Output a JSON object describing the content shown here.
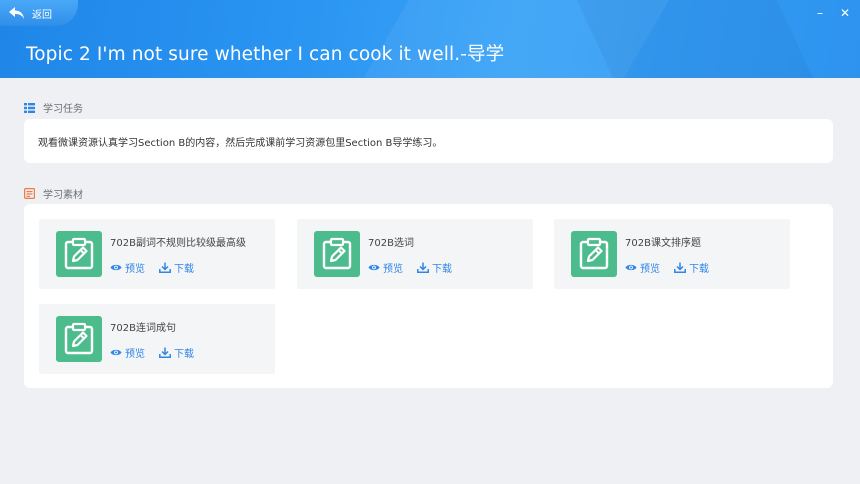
{
  "window": {
    "back_label": "返回",
    "minimize_symbol": "–",
    "close_symbol": "✕",
    "title": "Topic 2 I'm not sure whether I can cook it well.-导学",
    "brand_color": "#2a95f2"
  },
  "task": {
    "section_title": "学习任务",
    "section_icon": "list-icon",
    "text": "观看微课资源认真学习Section B的内容，然后完成课前学习资源包里Section B导学练习。"
  },
  "materials": {
    "section_title": "学习素材",
    "section_icon": "document-icon",
    "thumb_icon": "edit-clipboard-icon",
    "thumb_color": "#4cbc8c",
    "preview_label": "预览",
    "download_label": "下载",
    "items": [
      {
        "name": "702B副词不规则比较级最高级"
      },
      {
        "name": "702B选词"
      },
      {
        "name": "702B课文排序题"
      },
      {
        "name": "702B连词成句"
      }
    ]
  }
}
